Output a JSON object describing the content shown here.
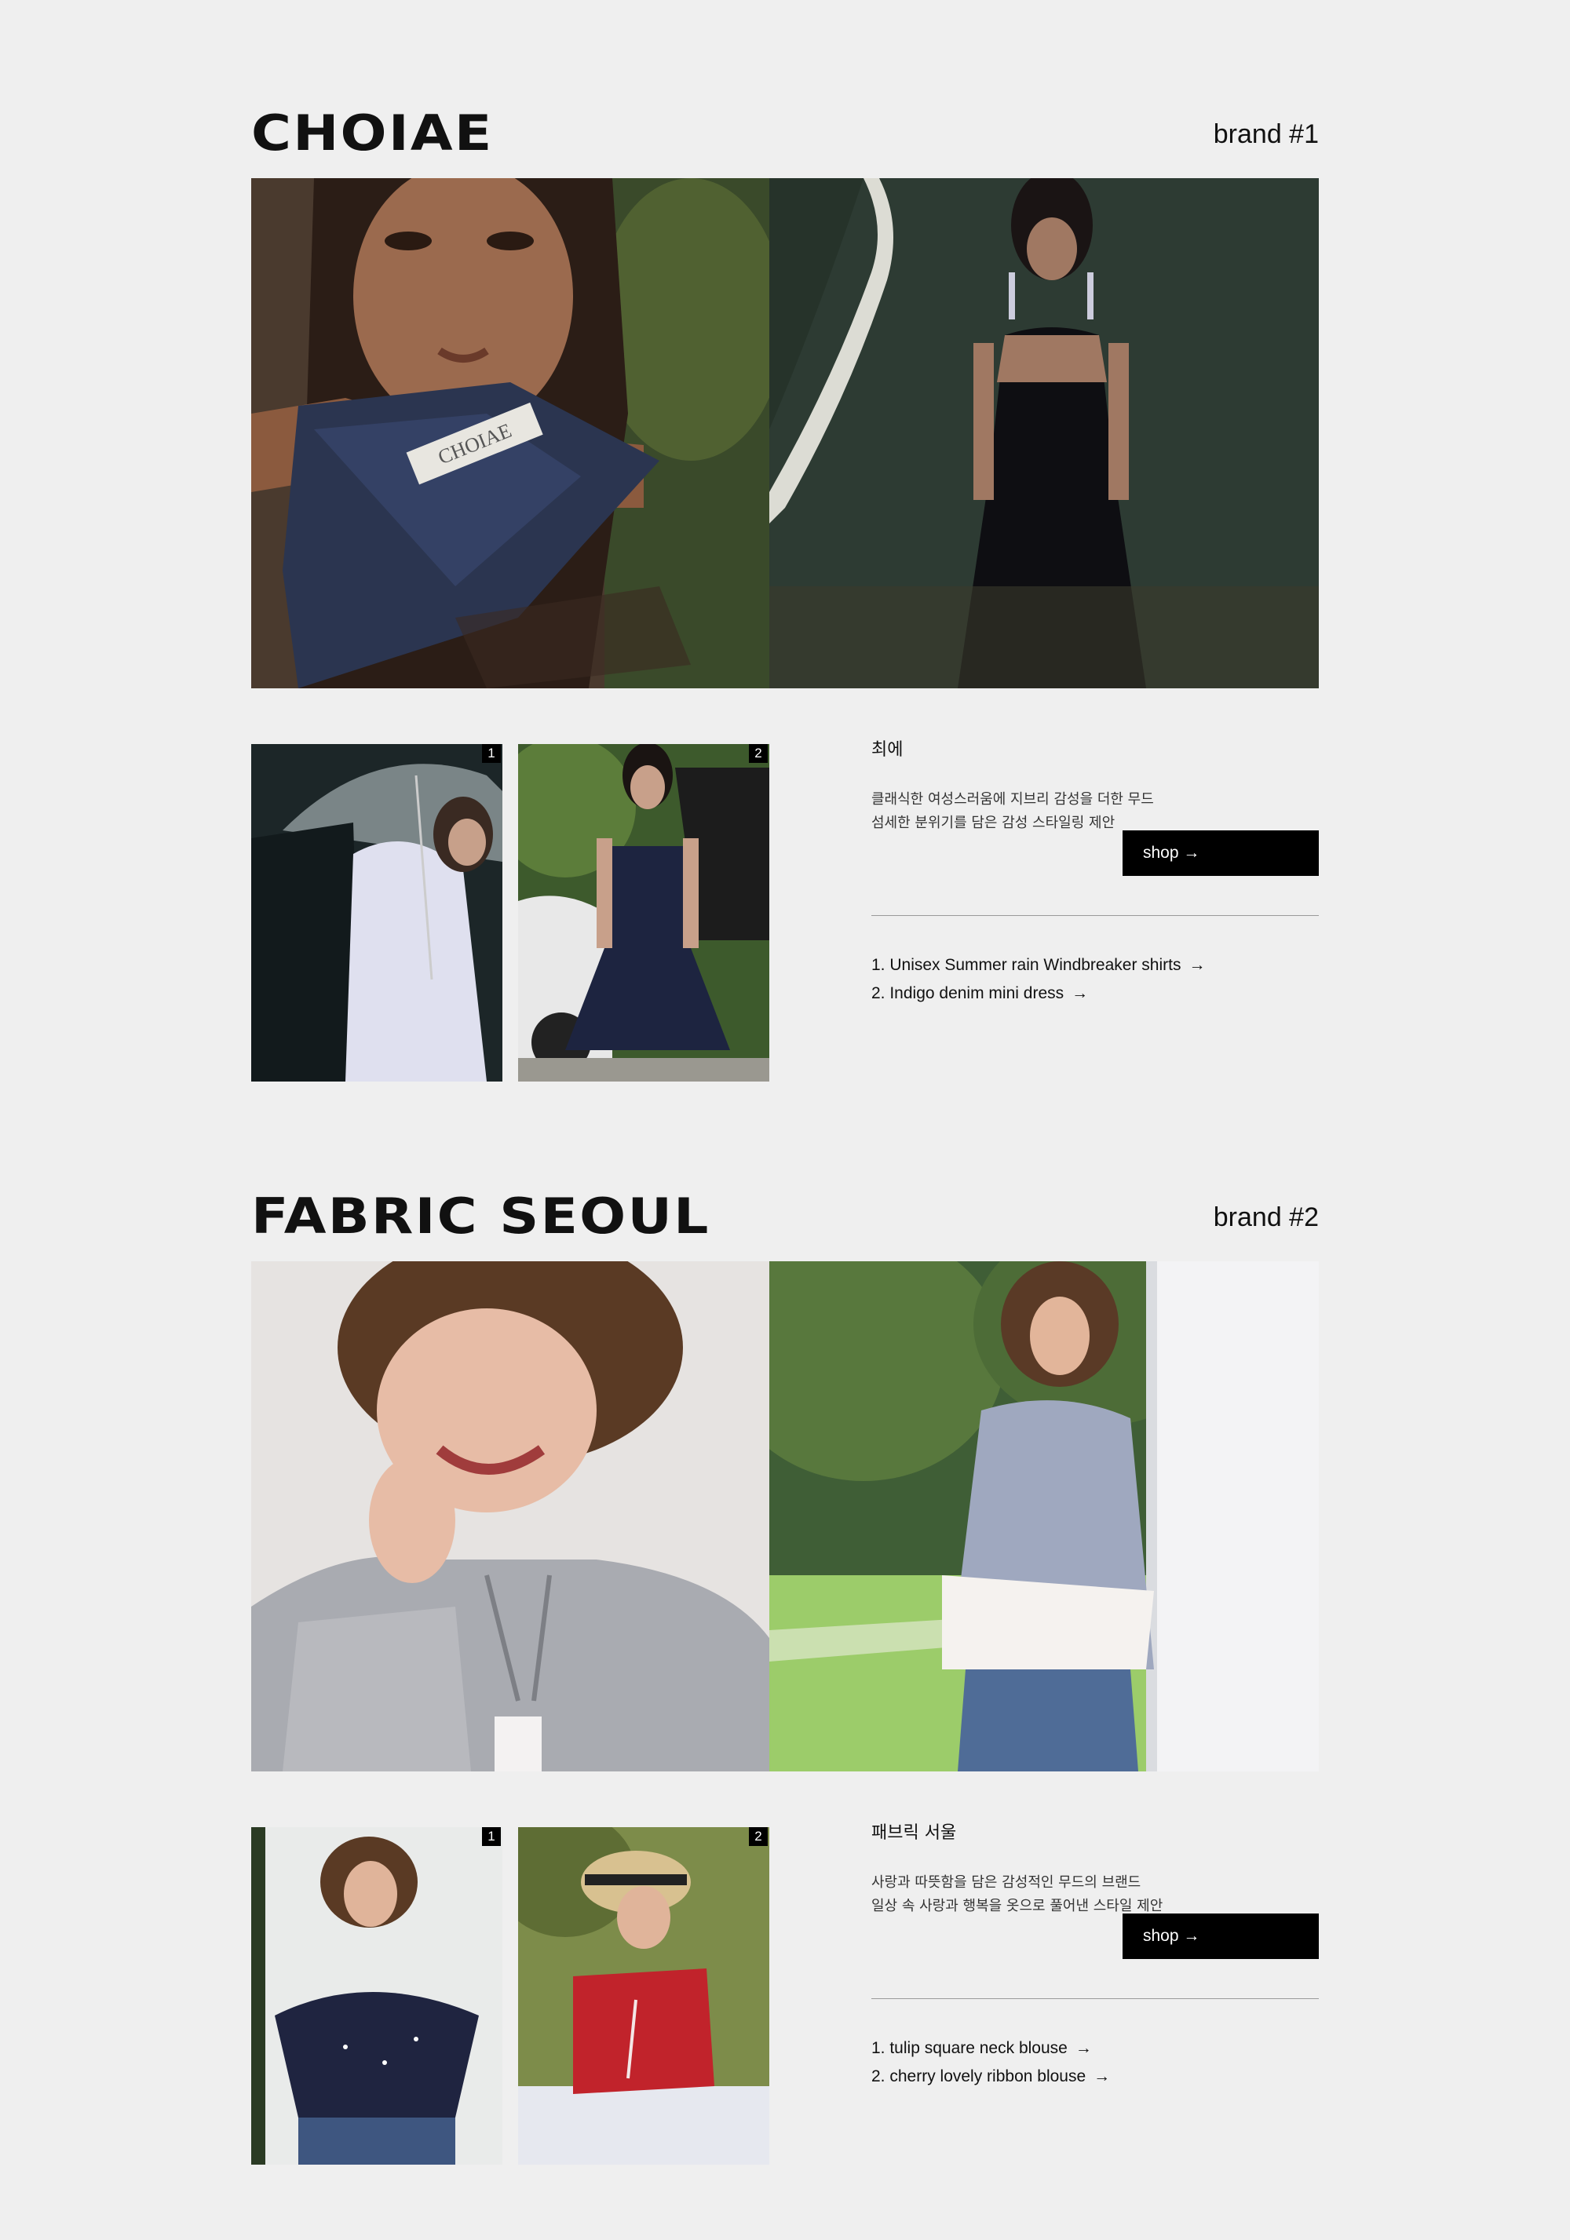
{
  "brands": [
    {
      "name": "CHOIAE",
      "number_label": "brand #1",
      "korean_name": "최에",
      "description": [
        "클래식한 여성스러움에 지브리 감성을 더한 무드",
        "섬세한 분위기를 담은 감성 스타일링 제안"
      ],
      "shop_label": "shop →",
      "thumb_badges": [
        "1",
        "2"
      ],
      "products": [
        {
          "text": "1. Unisex Summer rain Windbreaker shirts",
          "arrow": "→"
        },
        {
          "text": "2. Indigo denim mini dress",
          "arrow": "→"
        }
      ],
      "hero_label": "CHOIAE"
    },
    {
      "name": "FABRIC SEOUL",
      "number_label": "brand #2",
      "korean_name": "패브릭 서울",
      "description": [
        "사랑과 따뜻함을 담은 감성적인 무드의 브랜드",
        "일상 속 사랑과 행복을 옷으로 풀어낸 스타일 제안"
      ],
      "shop_label": "shop →",
      "thumb_badges": [
        "1",
        "2"
      ],
      "products": [
        {
          "text": "1. tulip square neck blouse",
          "arrow": "→"
        },
        {
          "text": "2. cherry lovely ribbon blouse",
          "arrow": "→"
        }
      ]
    }
  ]
}
